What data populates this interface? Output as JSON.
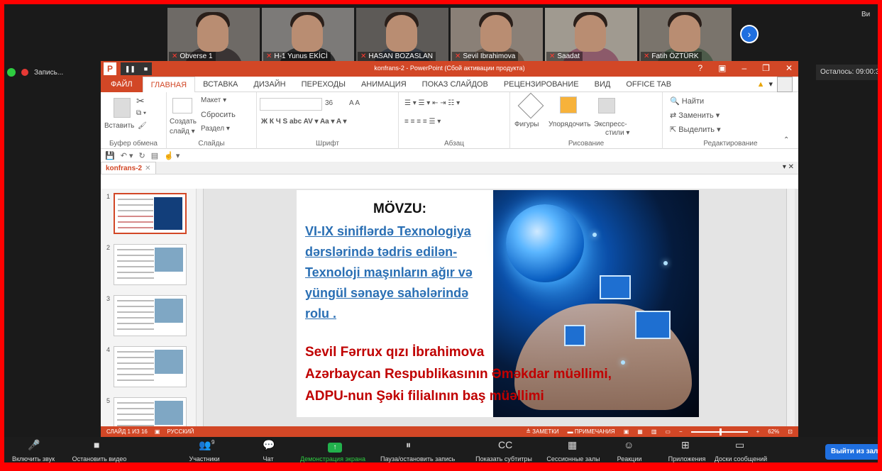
{
  "zoom_top": {
    "participants": [
      {
        "name": "Obverse 1",
        "bg": "#6e6a66",
        "body": "#3a3434"
      },
      {
        "name": "H-1 Yunus EKİCİ",
        "bg": "#7c7a78",
        "body": "#2c2c2c"
      },
      {
        "name": "HASAN BOZASLAN",
        "bg": "#5d5a57",
        "body": "#3a3f48"
      },
      {
        "name": "Sevil Ibrahimova",
        "bg": "#8a8077",
        "body": "#6b5a4e"
      },
      {
        "name": "Saadat",
        "bg": "#a09a90",
        "body": "#8c5a6a"
      },
      {
        "name": "Fatih ÖZTÜRK",
        "bg": "#7a746c",
        "body": "#4d5b4a"
      }
    ],
    "view_label": "Ви",
    "recording_label": "Запись...",
    "remaining_label": "Осталось: 09:00:3"
  },
  "ppt": {
    "title": "konfrans-2 -  PowerPoint (Сбой активации продукта)",
    "tabs": [
      "ФАЙЛ",
      "ГЛАВНАЯ",
      "ВСТАВКА",
      "ДИЗАЙН",
      "ПЕРЕХОДЫ",
      "АНИМАЦИЯ",
      "ПОКАЗ СЛАЙДОВ",
      "РЕЦЕНЗИРОВАНИЕ",
      "ВИД",
      "OFFICE TAB"
    ],
    "ribbon": {
      "paste": "Вставить",
      "clipboard": "Буфер обмена",
      "create": "Создать",
      "slide_dd": "слайд ▾",
      "layout": "Макет ▾",
      "reset": "Сбросить",
      "section": "Раздел ▾",
      "slides_group": "Слайды",
      "font_size": "36",
      "font_group": "Шрифт",
      "paragraph_group": "Абзац",
      "shapes": "Фигуры",
      "arrange": "Упорядочить",
      "quick_styles": "Экспресс-",
      "quick_styles2": "стили ▾",
      "drawing_group": "Рисование",
      "find": "Найти",
      "replace": "Заменить ▾",
      "select": "Выделить ▾",
      "editing_group": "Редактирование"
    },
    "doc_tab": "konfrans-2",
    "slide_numbers": [
      "1",
      "2",
      "3",
      "4",
      "5"
    ],
    "slide": {
      "heading": "MÖVZU:",
      "blue_lines": [
        "VI-IX siniflərdə Texnologiya",
        "dərslərində  tədris edilən-",
        "Texnoloji maşınların ağır və",
        "yüngül sənaye sahələrində",
        "rolu ."
      ],
      "red_lines": [
        "Sevil Fərrux qızı İbrahimova",
        "Azərbaycan Respublikasının Əməkdar müəllimi,",
        "ADPU-nun Şəki filialının baş müəllimi"
      ]
    },
    "status": {
      "slide_of": "СЛАЙД 1 ИЗ 16",
      "lang": "РУССКИЙ",
      "notes": "ЗАМЕТКИ",
      "comments": "ПРИМЕЧАНИЯ",
      "zoom": "62%",
      "zoom_fraction": 0.62
    }
  },
  "zoom_bottom": {
    "items": [
      {
        "label": "Включить звук",
        "icon": "🎤"
      },
      {
        "label": "Остановить видео",
        "icon": "■"
      },
      {
        "label": "Участники",
        "icon": "👥",
        "count": "9"
      },
      {
        "label": "Чат",
        "icon": "💬"
      },
      {
        "label": "Демонстрация экрана",
        "icon": "↑"
      },
      {
        "label": "Пауза/остановить запись",
        "icon": "⏸"
      },
      {
        "label": "Показать субтитры",
        "icon": "CC"
      },
      {
        "label": "Сессионные залы",
        "icon": "▦"
      },
      {
        "label": "Реакции",
        "icon": "☺"
      },
      {
        "label": "Приложения",
        "icon": "⊞"
      },
      {
        "label": "Доски сообщений",
        "icon": "▭"
      }
    ],
    "exit_label": "Выйти из зала"
  }
}
